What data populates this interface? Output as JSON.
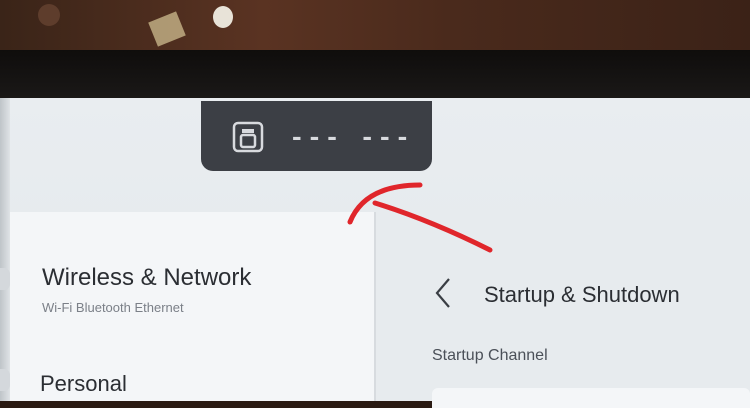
{
  "status_bar": {
    "cast_icon": "screen-cast-icon",
    "status_text": "--- ---"
  },
  "sidebar": {
    "items": [
      {
        "label": "Wireless & Network",
        "subtitle": "Wi-Fi Bluetooth Ethernet"
      },
      {
        "label": "Personal"
      }
    ]
  },
  "detail": {
    "back_icon": "chevron-left-icon",
    "title": "Startup & Shutdown",
    "section_label": "Startup Channel"
  },
  "colors": {
    "annotation": "#e0262b",
    "pill": "#3c3f45",
    "screen_bg": "#e9edf0"
  }
}
